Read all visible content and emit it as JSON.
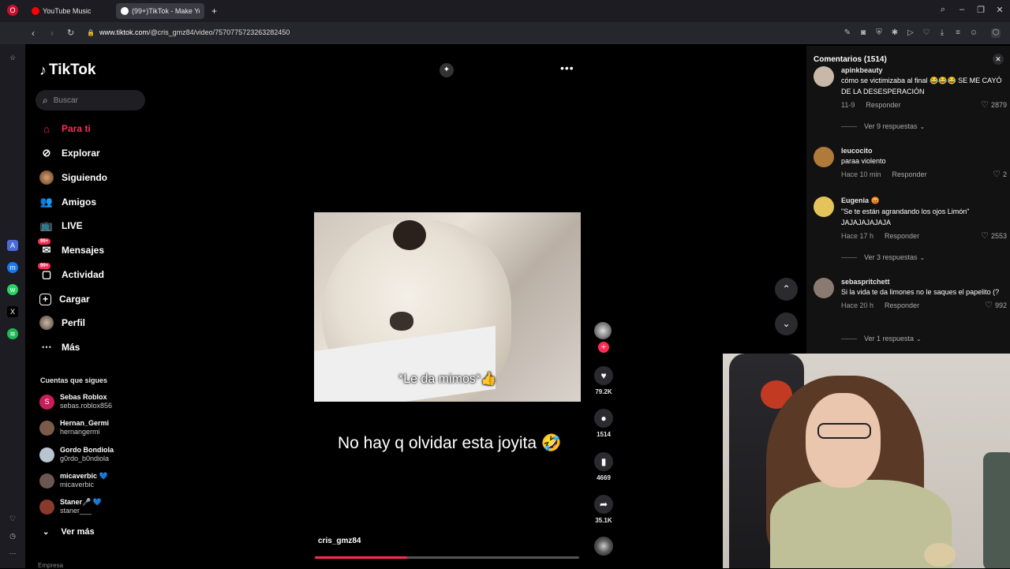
{
  "browser": {
    "tabs": [
      {
        "label": "YouTube Music",
        "active": false
      },
      {
        "label": "(99+)TikTok - Make Yo",
        "active": true
      }
    ],
    "new_tab": "+",
    "url_host": "www.tiktok.com",
    "url_path": "/@cris_gmz84/video/7570775723263282450"
  },
  "nav": {
    "logo": "TikTok",
    "search_placeholder": "Buscar",
    "items": [
      {
        "label": "Para ti",
        "icon": "home-icon",
        "active": true
      },
      {
        "label": "Explorar",
        "icon": "compass-icon"
      },
      {
        "label": "Siguiendo",
        "icon": "following-avatar-icon"
      },
      {
        "label": "Amigos",
        "icon": "friends-icon"
      },
      {
        "label": "LIVE",
        "icon": "live-tv-icon"
      },
      {
        "label": "Mensajes",
        "icon": "messages-icon",
        "badge": "99+"
      },
      {
        "label": "Actividad",
        "icon": "activity-icon",
        "badge": "99+"
      },
      {
        "label": "Cargar",
        "icon": "upload-plus-icon"
      },
      {
        "label": "Perfil",
        "icon": "profile-avatar-icon"
      },
      {
        "label": "Más",
        "icon": "more-dots-icon"
      }
    ],
    "following_heading": "Cuentas que sigues",
    "following": [
      {
        "name": "Sebas Roblox",
        "handle": "sebas.roblox856",
        "color": "#c81e5a"
      },
      {
        "name": "Hernan_Germi",
        "handle": "hernangermi",
        "color": "#7b5a4a"
      },
      {
        "name": "Gordo Bondiola",
        "handle": "g0rdo_b0ndiola",
        "color": "#b8c4d0"
      },
      {
        "name": "micaverbic 💙",
        "handle": "micaverbic",
        "color": "#6a5850"
      },
      {
        "name": "Staner🎤 💙",
        "handle": "staner___",
        "color": "#8a3a2a"
      }
    ],
    "see_more": "Ver más",
    "footer_cut": "Empresa"
  },
  "video": {
    "caption": "*Le da mimos*👍",
    "description": "No hay q olvidar esta joyita 🤣",
    "author": "cris_gmz84",
    "progress": 0.35,
    "likes": "79.2K",
    "comments": "1514",
    "saves": "4669",
    "shares": "35.1K"
  },
  "comments_panel": {
    "title": "Comentarios (1514)",
    "items": [
      {
        "user": "apinkbeauty",
        "text": "cómo se victimizaba al final 😂😂😂 SE ME CAYÓ DE LA DESESPERACIÓN",
        "time": "11-9",
        "reply": "Responder",
        "likes": "2879",
        "replies": "Ver 9 respuestas",
        "color": "#c9b8a8"
      },
      {
        "user": "leucocito",
        "text": "paraa violento",
        "time": "Hace 10 min",
        "reply": "Responder",
        "likes": "2",
        "color": "#b07a3a"
      },
      {
        "user": "Eugenia 😡",
        "text": "\"Se te están agrandando los ojos Limón\" JAJAJAJAJAJA",
        "time": "Hace 17 h",
        "reply": "Responder",
        "likes": "2553",
        "replies": "Ver 3 respuestas",
        "color": "#e4c45a"
      },
      {
        "user": "sebaspritchett",
        "text": "Si la vida te da limones no le saques el papelito (?",
        "time": "Hace 20 h",
        "reply": "Responder",
        "likes": "992",
        "replies": "Ver 1 respuesta",
        "color": "#8a7a70"
      }
    ]
  },
  "colors": {
    "accent": "#fe2c55",
    "panel": "#121212",
    "chrome": "#1c1c22"
  }
}
